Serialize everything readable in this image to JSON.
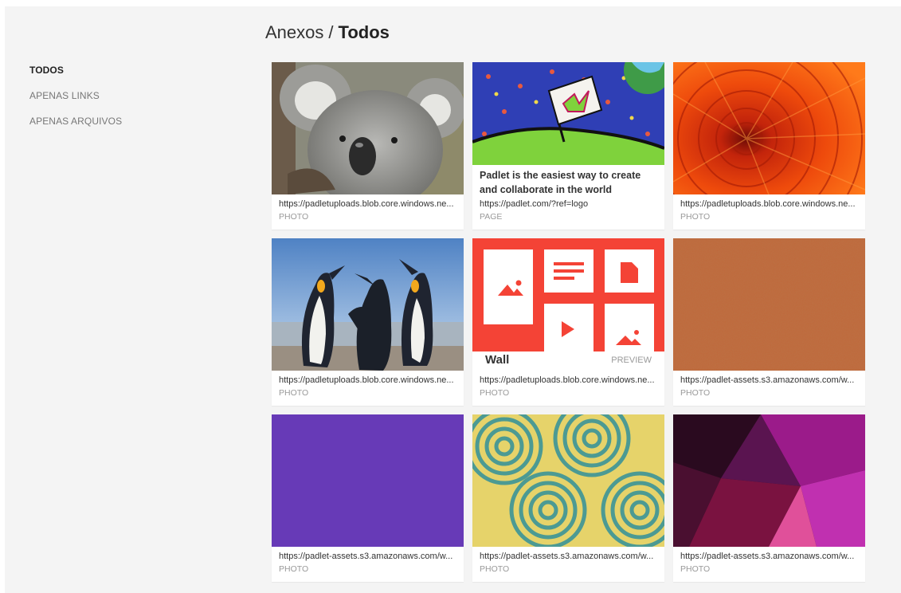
{
  "header": {
    "breadcrumb_parent": "Anexos",
    "separator": "/",
    "current": "Todos"
  },
  "sidebar": {
    "filters": [
      {
        "label": "TODOS",
        "active": true
      },
      {
        "label": "APENAS LINKS",
        "active": false
      },
      {
        "label": "APENAS ARQUIVOS",
        "active": false
      }
    ]
  },
  "colors": {
    "accent_red": "#f44336",
    "purple_tile": "#673ab7",
    "pattern_yellow": "#e6d36a",
    "pattern_teal": "#4c9a93"
  },
  "cards": [
    {
      "url": "https://padletuploads.blob.core.windows.ne...",
      "kind": "PHOTO",
      "image": "koala-photo"
    },
    {
      "title": "Padlet is the easiest way to create and collaborate in the world",
      "url": "https://padlet.com/?ref=logo",
      "kind": "PAGE",
      "image": "padlet-drawing"
    },
    {
      "url": "https://padletuploads.blob.core.windows.ne...",
      "kind": "PHOTO",
      "image": "red-flower-photo"
    },
    {
      "url": "https://padletuploads.blob.core.windows.ne...",
      "kind": "PHOTO",
      "image": "penguins-photo"
    },
    {
      "wall_name": "Wall",
      "wall_preview": "PREVIEW",
      "url": "https://padletuploads.blob.core.windows.ne...",
      "kind": "PHOTO",
      "image": "wall-preview-graphic"
    },
    {
      "url": "https://padlet-assets.s3.amazonaws.com/w...",
      "kind": "PHOTO",
      "image": "brown-texture"
    },
    {
      "url": "https://padlet-assets.s3.amazonaws.com/w...",
      "kind": "PHOTO",
      "image": "purple-solid"
    },
    {
      "url": "https://padlet-assets.s3.amazonaws.com/w...",
      "kind": "PHOTO",
      "image": "swirl-pattern"
    },
    {
      "url": "https://padlet-assets.s3.amazonaws.com/w...",
      "kind": "PHOTO",
      "image": "purple-polygon"
    }
  ]
}
